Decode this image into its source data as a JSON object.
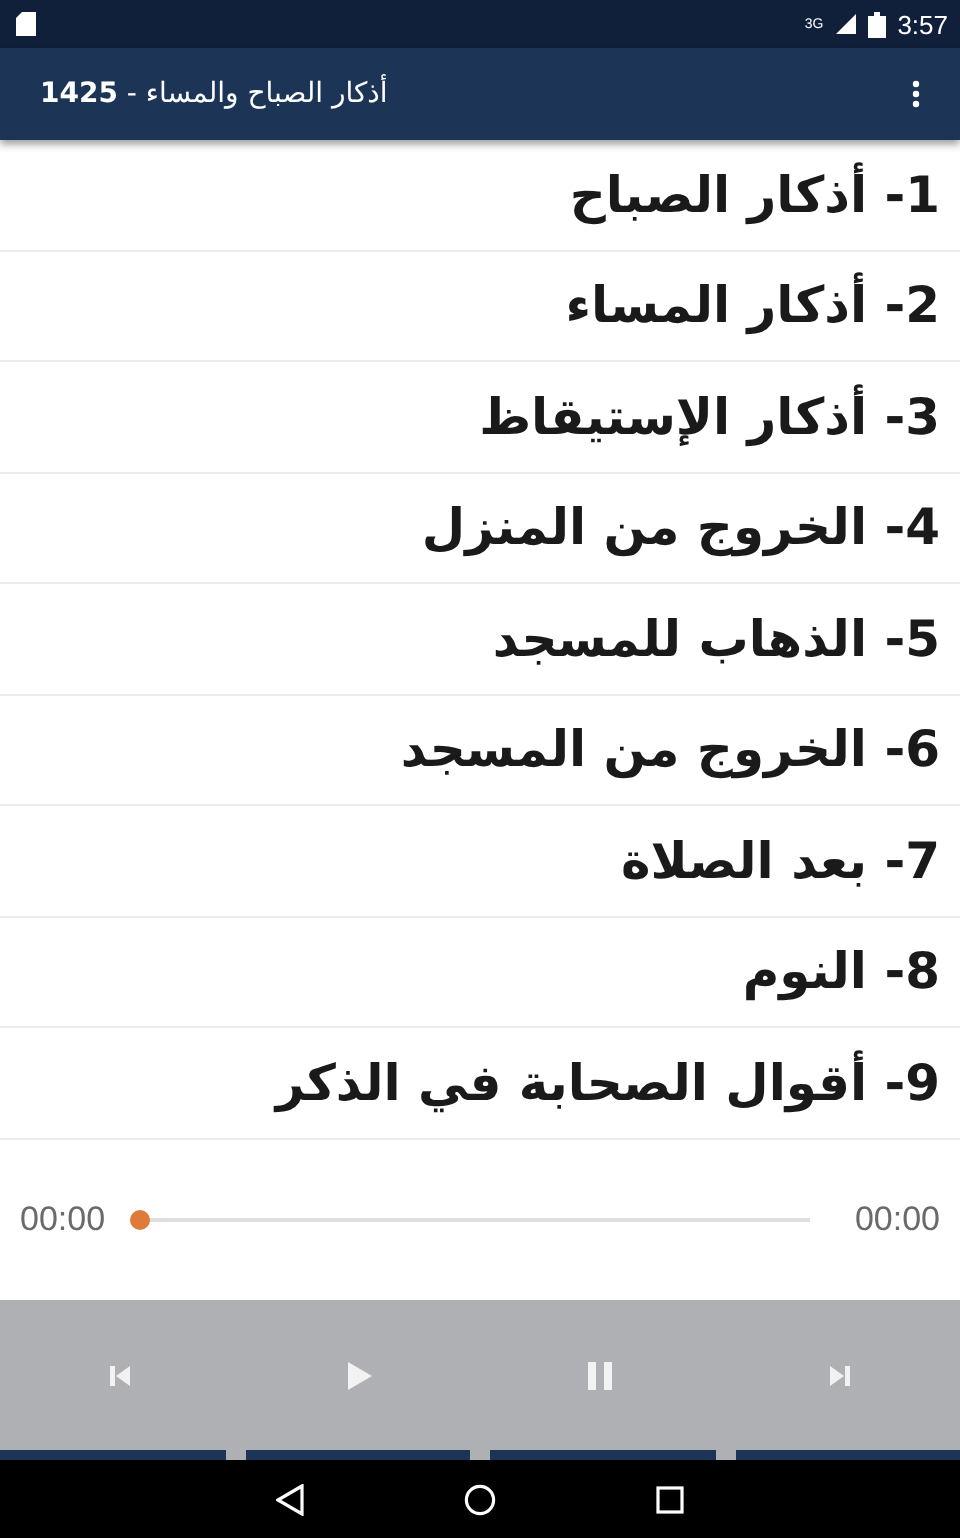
{
  "status_bar": {
    "network": "3G",
    "time": "3:57"
  },
  "app_bar": {
    "title": "أذكار الصباح والمساء - **1425**"
  },
  "list": {
    "items": [
      {
        "label": "1- أذكار الصباح"
      },
      {
        "label": "2- أذكار المساء"
      },
      {
        "label": "3- أذكار الإستيقاظ"
      },
      {
        "label": "4- الخروج من المنزل"
      },
      {
        "label": "5- الذهاب للمسجد"
      },
      {
        "label": "6- الخروج من المسجد"
      },
      {
        "label": "7- بعد الصلاة"
      },
      {
        "label": "8- النوم"
      },
      {
        "label": "9- أقوال الصحابة في الذكر"
      }
    ]
  },
  "player": {
    "elapsed": "00:00",
    "duration": "00:00",
    "seek": {
      "level": 0
    },
    "controls": [
      {
        "kind": "previous"
      },
      {
        "kind": "play"
      },
      {
        "kind": "pause"
      },
      {
        "kind": "next"
      }
    ]
  }
}
